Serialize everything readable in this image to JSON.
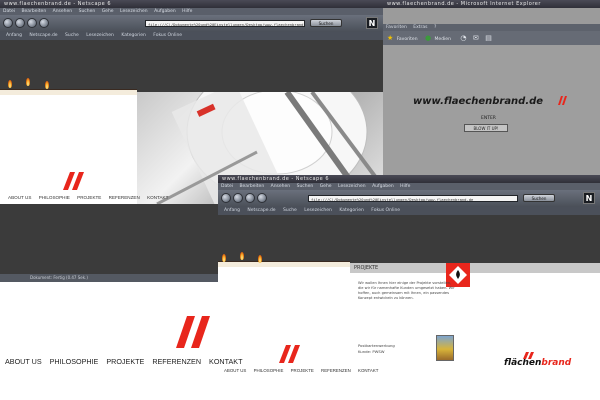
{
  "w1": {
    "title": "www.flaechenbrand.de - Netscape 6",
    "menu": [
      "Datei",
      "Bearbeiten",
      "Ansehen",
      "Suchen",
      "Gehe",
      "Lesezeichen",
      "Aufgaben",
      "Hilfe"
    ],
    "url": "file:///C|/Dokumente%20und%20Einstellungen/Desktop/www.flaechenbrand.de",
    "search": "Suchen",
    "bookmarks": [
      "Anfang",
      "Netscape.de",
      "Suche",
      "Lesezeichen",
      "Kategorien",
      "Fokus Online"
    ],
    "nav": [
      "ABOUT US",
      "PHILOSOPHIE",
      "PROJEKTE",
      "REFERENZEN",
      "KONTAKT"
    ],
    "status": "Dokument: Fertig (0.47 Sek.)"
  },
  "w2": {
    "title": "www.flaechenbrand.de - Microsoft Internet Explorer",
    "menu": [
      "Favoriten",
      "Extras",
      "?"
    ],
    "toolbar": [
      "Favoriten",
      "Medien"
    ],
    "logo": "www.flaechenbrand.de",
    "enter": "ENTER",
    "button": "BLOW IT UP!"
  },
  "w3": {
    "title": "www.flaechenbrand.de - Netscape 6",
    "menu": [
      "Datei",
      "Bearbeiten",
      "Ansehen",
      "Suchen",
      "Gehe",
      "Lesezeichen",
      "Aufgaben",
      "Hilfe"
    ],
    "url": "file:///C|/Dokumente%20und%20Einstellungen/Desktop/www.flaechenbrand.de",
    "search": "Suchen",
    "bookmarks": [
      "Anfang",
      "Netscape.de",
      "Suche",
      "Lesezeichen",
      "Kategorien",
      "Fokus Online"
    ],
    "nav": [
      "ABOUT US",
      "PHILOSOPHIE",
      "PROJEKTE",
      "REFERENZEN",
      "KONTAKT"
    ],
    "section": "PROJEKTE",
    "text": "Wir wollen Ihnen hier einige der Projekte vorstellen, die wir für namenhafte Kunden umgesetzt haben. Wir hoffen, auch gemeinsam mit Ihnen, ein passendes Konzept entwickeln zu können.",
    "project": "Postkartenwerbung",
    "client": "Kunde: PWSW",
    "brand_left": "flächen",
    "brand_right": "brand"
  },
  "big_nav": [
    "ABOUT US",
    "PHILOSOPHIE",
    "PROJEKTE",
    "REFERENZEN",
    "KONTAKT"
  ],
  "colors": {
    "brand_red": "#e8261c",
    "dark": "#3b3b3b",
    "chrome": "#5a5f6a"
  }
}
